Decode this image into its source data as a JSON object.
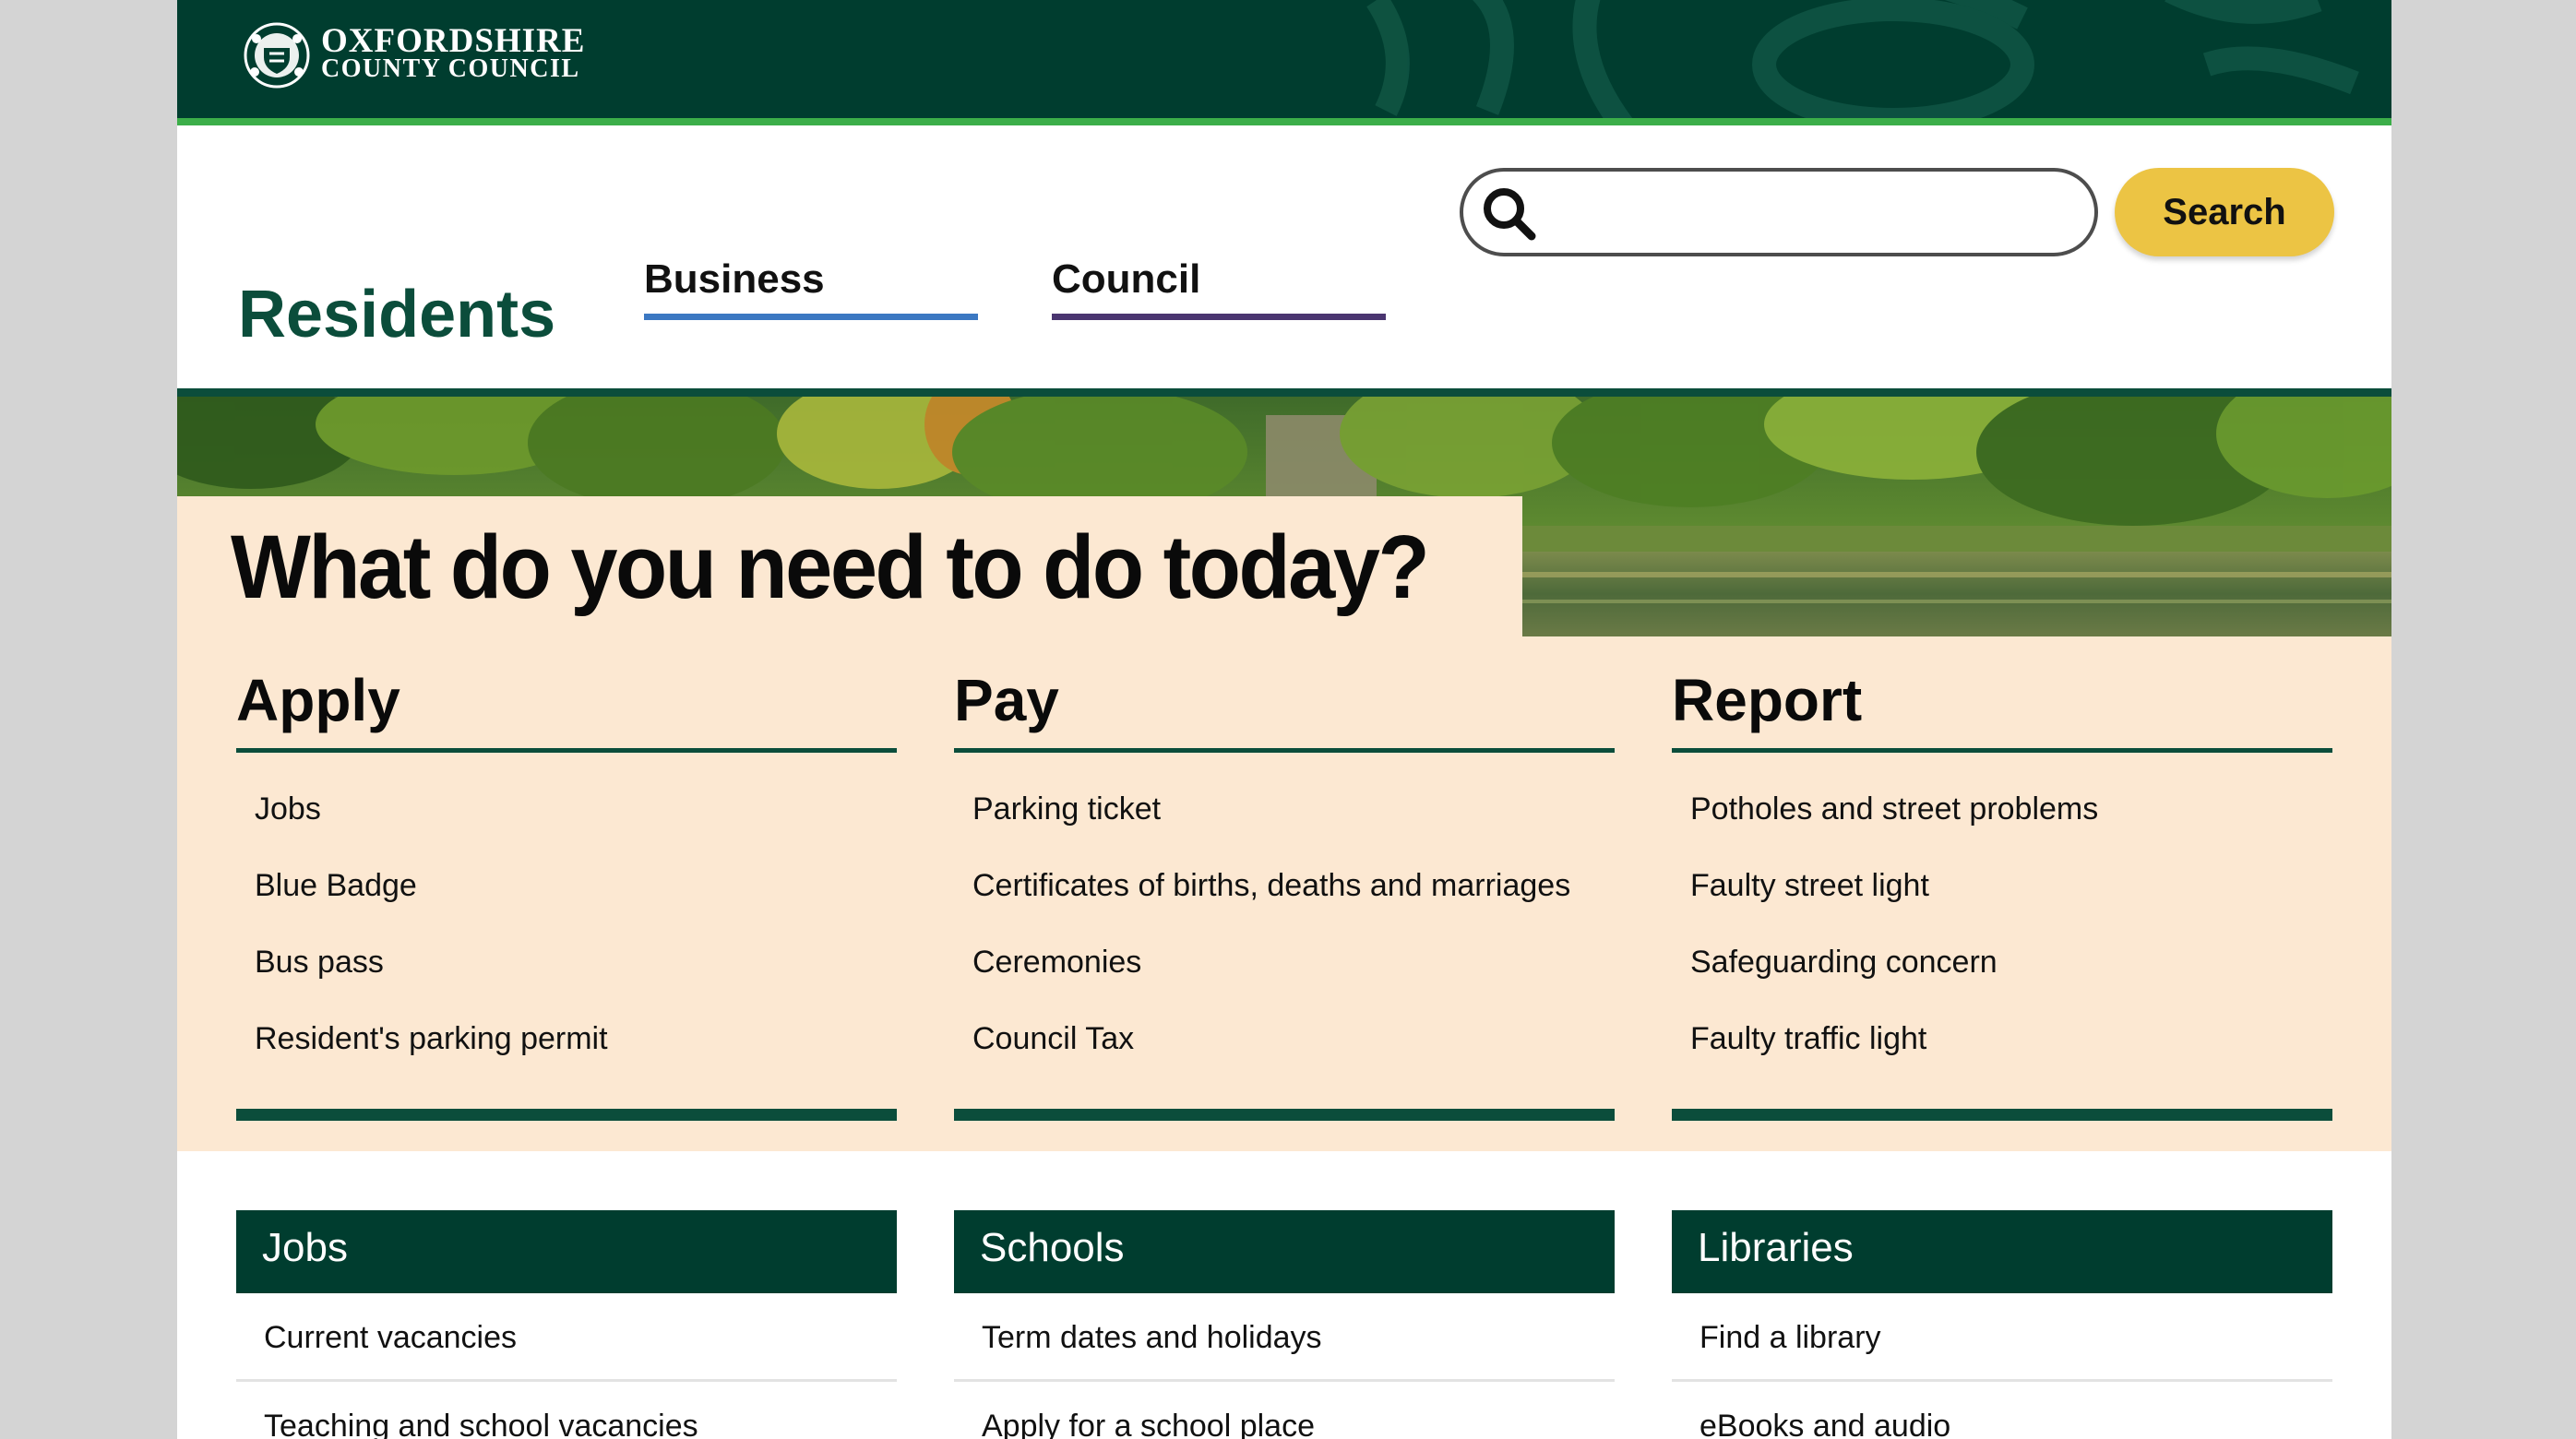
{
  "header": {
    "logo_line1": "OXFORDSHIRE",
    "logo_line2": "COUNTY COUNCIL",
    "brand_color": "#003d2f",
    "accent_bar_color": "#3cae49"
  },
  "nav": {
    "active": "Residents",
    "tabs": [
      "Business",
      "Council"
    ],
    "tab_colors": [
      "#3b78c2",
      "#4a3570"
    ]
  },
  "search": {
    "value": "",
    "placeholder": "",
    "button_label": "Search",
    "button_color": "#ecc444"
  },
  "hero": {
    "title": "What do you need to do today?",
    "panel_color": "#fce8d2"
  },
  "tasks": [
    {
      "heading": "Apply",
      "links": [
        "Jobs",
        "Blue Badge",
        "Bus pass",
        "Resident's parking permit"
      ]
    },
    {
      "heading": "Pay",
      "links": [
        "Parking ticket",
        "Certificates of births, deaths and marriages",
        "Ceremonies",
        "Council Tax"
      ]
    },
    {
      "heading": "Report",
      "links": [
        "Potholes and street problems",
        "Faulty street light",
        "Safeguarding concern",
        "Faulty traffic light"
      ]
    }
  ],
  "cards": [
    {
      "heading": "Jobs",
      "links": [
        "Current vacancies",
        "Teaching and school vacancies"
      ]
    },
    {
      "heading": "Schools",
      "links": [
        "Term dates and holidays",
        "Apply for a school place"
      ]
    },
    {
      "heading": "Libraries",
      "links": [
        "Find a library",
        "eBooks and audio"
      ]
    }
  ]
}
